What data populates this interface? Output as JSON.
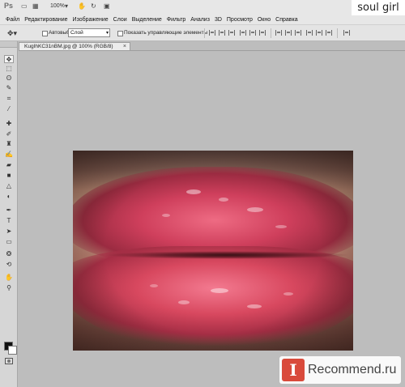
{
  "app": {
    "logo": "Ps",
    "zoom": "100%",
    "watermark": "soul girl"
  },
  "menu": {
    "items": [
      "Файл",
      "Редактирование",
      "Изображение",
      "Слои",
      "Выделение",
      "Фильтр",
      "Анализ",
      "3D",
      "Просмотр",
      "Окно",
      "Справка"
    ]
  },
  "options": {
    "autoselect_label": "Автовыбор:",
    "autoselect_value": "Слой",
    "show_controls_label": "Показать управляющие элементы"
  },
  "document": {
    "tab_title": "KugIhKC31nBM.jpg @ 100% (RGB/8)",
    "close": "×"
  },
  "tools": [
    "move-tool",
    "marquee-tool",
    "lasso-tool",
    "quick-select-tool",
    "crop-tool",
    "eyedropper-tool",
    "healing-brush-tool",
    "brush-tool",
    "clone-stamp-tool",
    "history-brush-tool",
    "eraser-tool",
    "gradient-tool",
    "blur-tool",
    "dodge-tool",
    "pen-tool",
    "type-tool",
    "path-select-tool",
    "shape-tool",
    "3d-rotate-tool",
    "3d-orbit-tool",
    "hand-tool",
    "zoom-tool"
  ],
  "colors": {
    "foreground": "#111111",
    "background": "#ffffff",
    "canvas_bg": "#bdbdbd",
    "badge_red": "#d94a3b"
  },
  "badge": {
    "icon_letter": "I",
    "text": "Recommend.ru"
  }
}
